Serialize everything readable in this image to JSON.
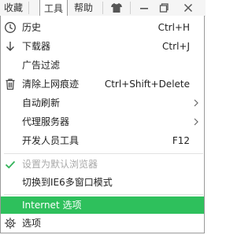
{
  "menubar": {
    "items": [
      {
        "label": "收藏"
      },
      {
        "label": "工具"
      },
      {
        "label": "帮助"
      }
    ],
    "icons": [
      "shirt-icon",
      "minimize-icon",
      "restore-icon",
      "close-icon"
    ]
  },
  "tools_menu": {
    "items": [
      {
        "label": "历史",
        "shortcut": "Ctrl+H",
        "icon": "history-clock-icon"
      },
      {
        "label": "下载器",
        "shortcut": "Ctrl+J",
        "icon": "download-arrow-icon"
      },
      {
        "label": "广告过滤",
        "shortcut": ""
      },
      {
        "label": "清除上网痕迹",
        "shortcut": "Ctrl+Shift+Delete",
        "icon": "trash-icon"
      },
      {
        "label": "自动刷新",
        "submenu": true
      },
      {
        "label": "代理服务器",
        "submenu": true
      },
      {
        "label": "开发人员工具",
        "shortcut": "F12"
      },
      {
        "label": "设置为默认浏览器",
        "disabled": true,
        "icon": "checkmark-icon"
      },
      {
        "label": "切换到IE6多窗口模式"
      },
      {
        "label": "Internet 选项",
        "highlighted": true
      },
      {
        "label": "选项",
        "icon": "gear-icon"
      }
    ]
  },
  "colors": {
    "highlight": "#2ec05c",
    "checkmark": "#34b35a",
    "disabled_text": "#a8a8a8"
  }
}
